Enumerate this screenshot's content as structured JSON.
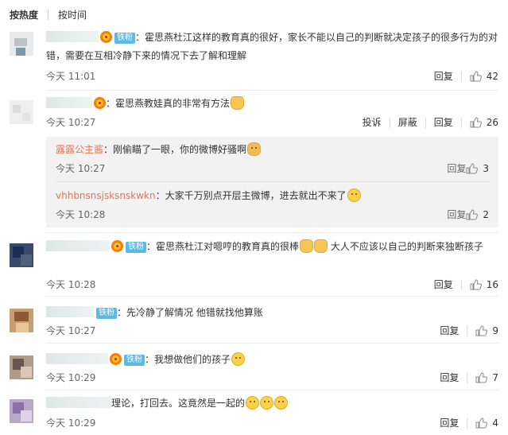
{
  "sort": {
    "hot": "按热度",
    "time": "按时间"
  },
  "labels": {
    "reply": "回复",
    "report": "投诉",
    "block": "屏蔽",
    "fan_badge": "铁粉"
  },
  "comments": [
    {
      "text": "：霍思燕杜江这样的教育真的很好，家长不能以自己的判断就决定孩子的很多行为的对错，需要在互相冷静下来的情况下去了解和理解",
      "time": "今天 11:01",
      "likes": "42"
    },
    {
      "text": "：霍思燕教娃真的非常有方法",
      "time": "今天 10:27",
      "likes": "26"
    },
    {
      "text": "：霍思燕杜江对嗯哼的教育真的很棒",
      "text2": "大人不应该以自己的判断来独断孩子",
      "time": "今天 10:28",
      "likes": "16"
    },
    {
      "text": "：先冷静了解情况 他错就找他算账",
      "time": "今天 10:27",
      "likes": "9"
    },
    {
      "text": "：我想做他们的孩子",
      "time": "今天 10:29",
      "likes": "7"
    },
    {
      "text": "理论，打回去。这竟然是一起的",
      "time": "今天 10:29",
      "likes": "4"
    }
  ],
  "replies": [
    {
      "name": "露露公主酱",
      "text": "：刚偷瞄了一眼，你的微博好骚啊",
      "time": "今天 10:27",
      "likes": "3"
    },
    {
      "name": "vhhbnsnsjsksnskwkn",
      "text": "：大家千万别点开层主微博，进去就出不来了",
      "time": "今天 10:28",
      "likes": "2"
    }
  ],
  "icons": {
    "like": "thumbs-up-icon",
    "vip": "crown-badge-icon"
  },
  "colors": {
    "link": "#eb7350",
    "badge": "#5cb8e4",
    "sub_bg": "#f2f2f2"
  }
}
